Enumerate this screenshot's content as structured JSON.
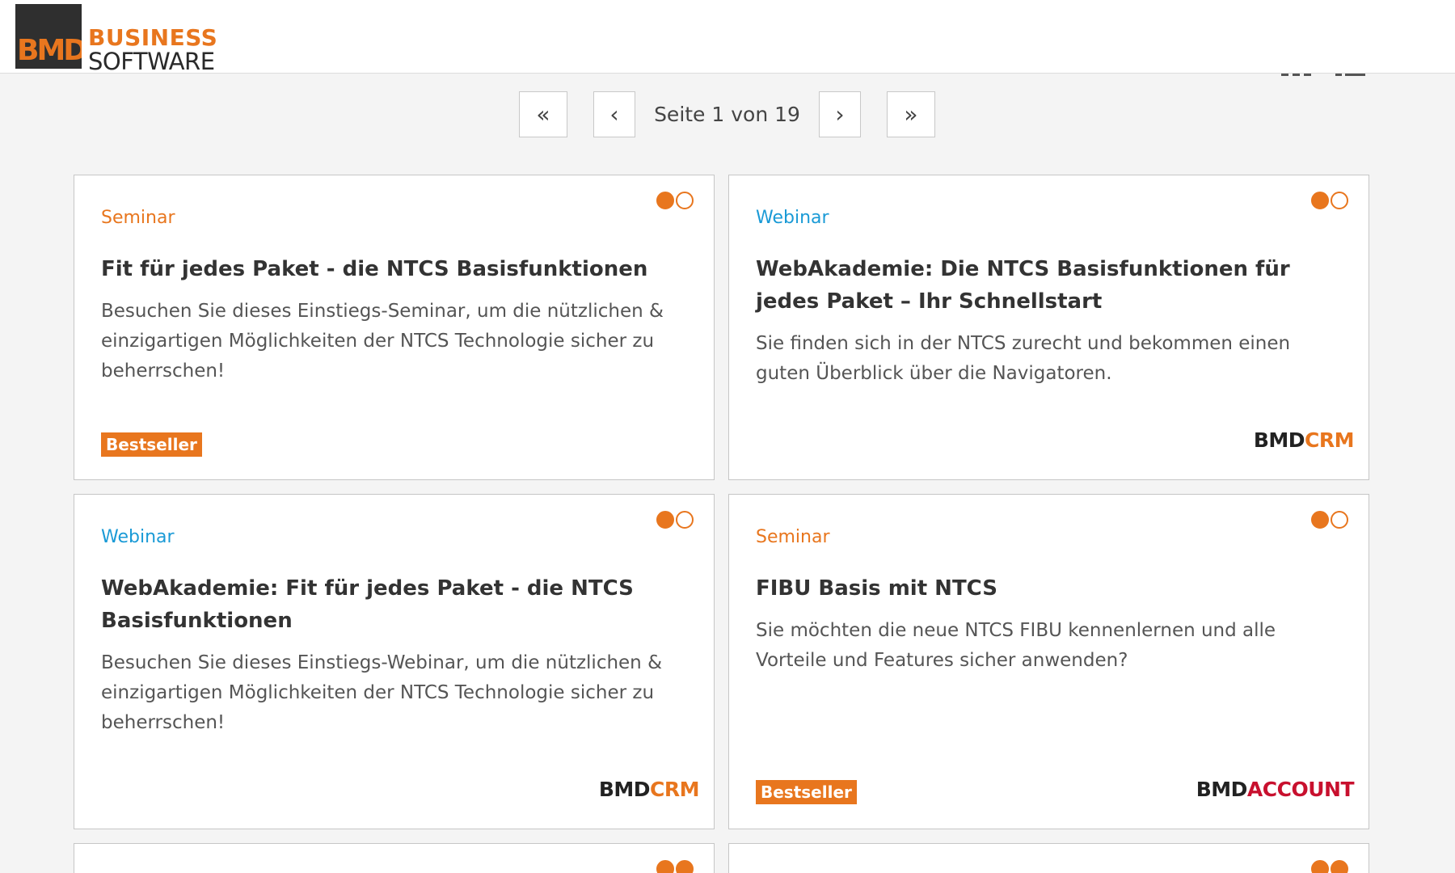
{
  "header": {
    "logo_mark_text": "BMD",
    "logo_line1": "BUSINESS",
    "logo_line2": "SOFTWARE"
  },
  "view_icons": [
    "grid-view-icon",
    "list-view-icon"
  ],
  "pager": {
    "first": "«",
    "prev": "‹",
    "label": "Seite 1 von 19",
    "next": "›",
    "last": "»",
    "current_page": 1,
    "total_pages": 19
  },
  "colors": {
    "accent": "#e8761e",
    "webinar": "#1a9ad6",
    "account_red": "#c8102e"
  },
  "cards": [
    {
      "type": "Seminar",
      "title": "Fit für jedes Paket - die NTCS Basisfunktionen",
      "description": "Besuchen Sie dieses Einstiegs-Seminar, um die nützlichen & einzigartigen Möglichkeiten der NTCS Technologie sicher zu beherrschen!",
      "badge": "Bestseller"
    },
    {
      "type": "Webinar",
      "title": "WebAkademie: Die NTCS Basisfunktionen für jedes Paket – Ihr Schnellstart",
      "description": "Sie finden sich in der NTCS zurecht und bekommen einen guten Überblick über die Navigatoren.",
      "brand_1": "BMD",
      "brand_2": "CRM"
    },
    {
      "type": "Webinar",
      "title": "WebAkademie: Fit für jedes Paket - die NTCS Basisfunktionen",
      "description": "Besuchen Sie dieses Einstiegs-Webinar, um die nützlichen & einzigartigen Möglichkeiten der NTCS Technologie sicher zu beherrschen!",
      "brand_1": "BMD",
      "brand_2": "CRM"
    },
    {
      "type": "Seminar",
      "title": "FIBU Basis mit NTCS",
      "description": "Sie möchten die neue NTCS FIBU kennenlernen und alle Vorteile und Features sicher anwenden?",
      "badge": "Bestseller",
      "brand_1": "BMD",
      "brand_2": "ACCOUNT"
    }
  ]
}
